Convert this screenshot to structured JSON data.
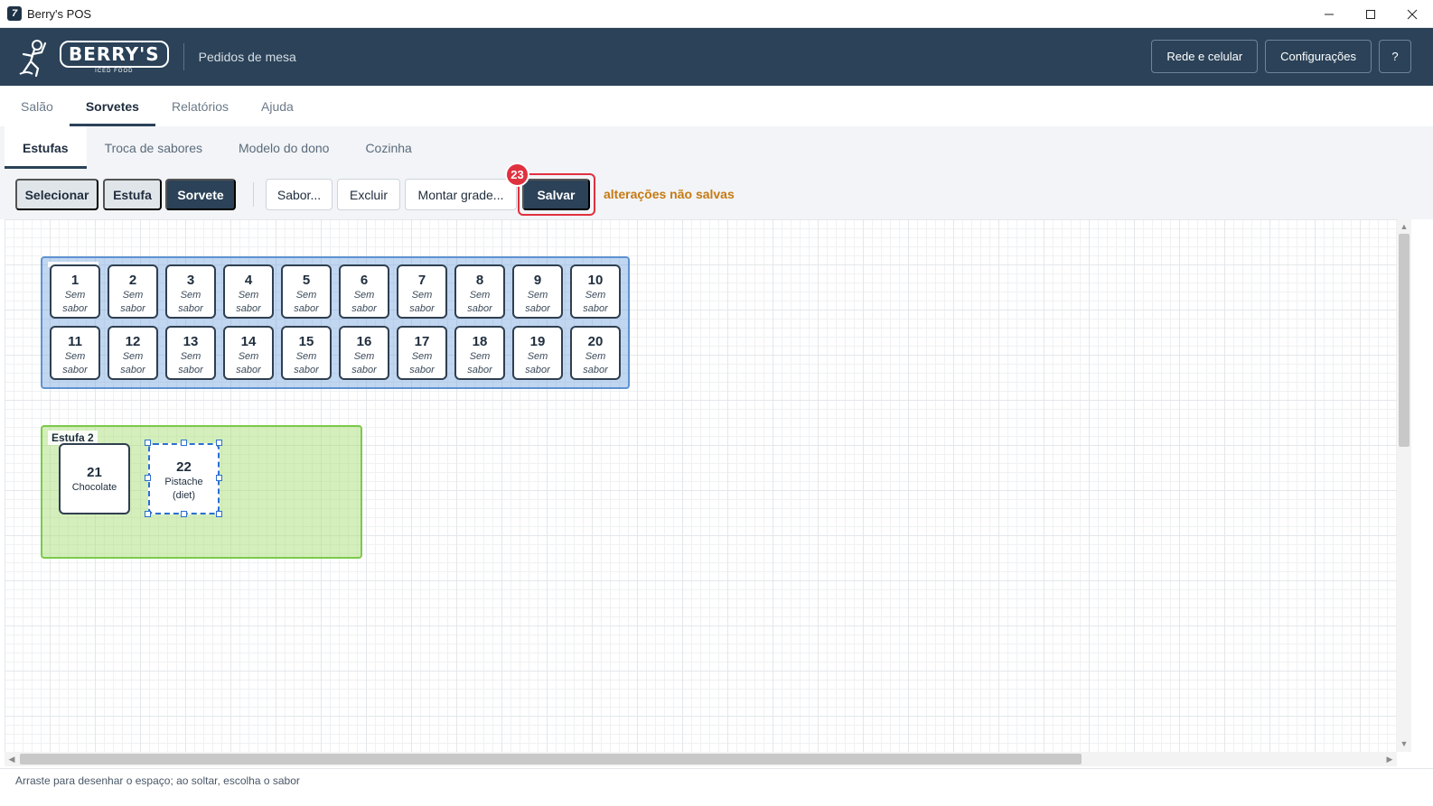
{
  "window": {
    "title": "Berry's POS"
  },
  "header": {
    "logo_text": "BERRY'S",
    "logo_sub": "ICED FOOD",
    "subtitle": "Pedidos de mesa",
    "actions": [
      "Rede e celular",
      "Configurações",
      "?"
    ]
  },
  "main_tabs": [
    {
      "label": "Salão",
      "active": false
    },
    {
      "label": "Sorvetes",
      "active": true
    },
    {
      "label": "Relatórios",
      "active": false
    },
    {
      "label": "Ajuda",
      "active": false
    }
  ],
  "sub_tabs": [
    {
      "label": "Estufas",
      "active": true
    },
    {
      "label": "Troca de sabores",
      "active": false
    },
    {
      "label": "Modelo do dono",
      "active": false
    },
    {
      "label": "Cozinha",
      "active": false
    }
  ],
  "toolbar": {
    "modes": [
      "Selecionar",
      "Estufa",
      "Sorvete"
    ],
    "active_mode": "Sorvete",
    "sabor_label": "Sabor...",
    "excluir_label": "Excluir",
    "montar_label": "Montar grade...",
    "save_label": "Salvar",
    "save_badge": "23",
    "unsaved_text": "alterações não salvas"
  },
  "estufas": [
    {
      "label": "",
      "color": "#5f93d3",
      "cells": [
        {
          "num": "1",
          "flavor": "Sem sabor"
        },
        {
          "num": "2",
          "flavor": "Sem sabor"
        },
        {
          "num": "3",
          "flavor": "Sem sabor"
        },
        {
          "num": "4",
          "flavor": "Sem sabor"
        },
        {
          "num": "5",
          "flavor": "Sem sabor"
        },
        {
          "num": "6",
          "flavor": "Sem sabor"
        },
        {
          "num": "7",
          "flavor": "Sem sabor"
        },
        {
          "num": "8",
          "flavor": "Sem sabor"
        },
        {
          "num": "9",
          "flavor": "Sem sabor"
        },
        {
          "num": "10",
          "flavor": "Sem sabor"
        },
        {
          "num": "11",
          "flavor": "Sem sabor"
        },
        {
          "num": "12",
          "flavor": "Sem sabor"
        },
        {
          "num": "13",
          "flavor": "Sem sabor"
        },
        {
          "num": "14",
          "flavor": "Sem sabor"
        },
        {
          "num": "15",
          "flavor": "Sem sabor"
        },
        {
          "num": "16",
          "flavor": "Sem sabor"
        },
        {
          "num": "17",
          "flavor": "Sem sabor"
        },
        {
          "num": "18",
          "flavor": "Sem sabor"
        },
        {
          "num": "19",
          "flavor": "Sem sabor"
        },
        {
          "num": "20",
          "flavor": "Sem sabor"
        }
      ]
    },
    {
      "label": "Estufa 2",
      "color": "#7cc94a",
      "cells": [
        {
          "num": "21",
          "flavor": "Chocolate",
          "selected": false
        },
        {
          "num": "22",
          "flavor": "Pistache (diet)",
          "selected": true
        }
      ]
    }
  ],
  "status": {
    "hint": "Arraste para desenhar o espaço; ao soltar, escolha o sabor"
  },
  "colors": {
    "header_bg": "#2b4258",
    "accent_red": "#e0313f",
    "unsaved_orange": "#c77a11",
    "selection_blue": "#2b6fd1"
  }
}
